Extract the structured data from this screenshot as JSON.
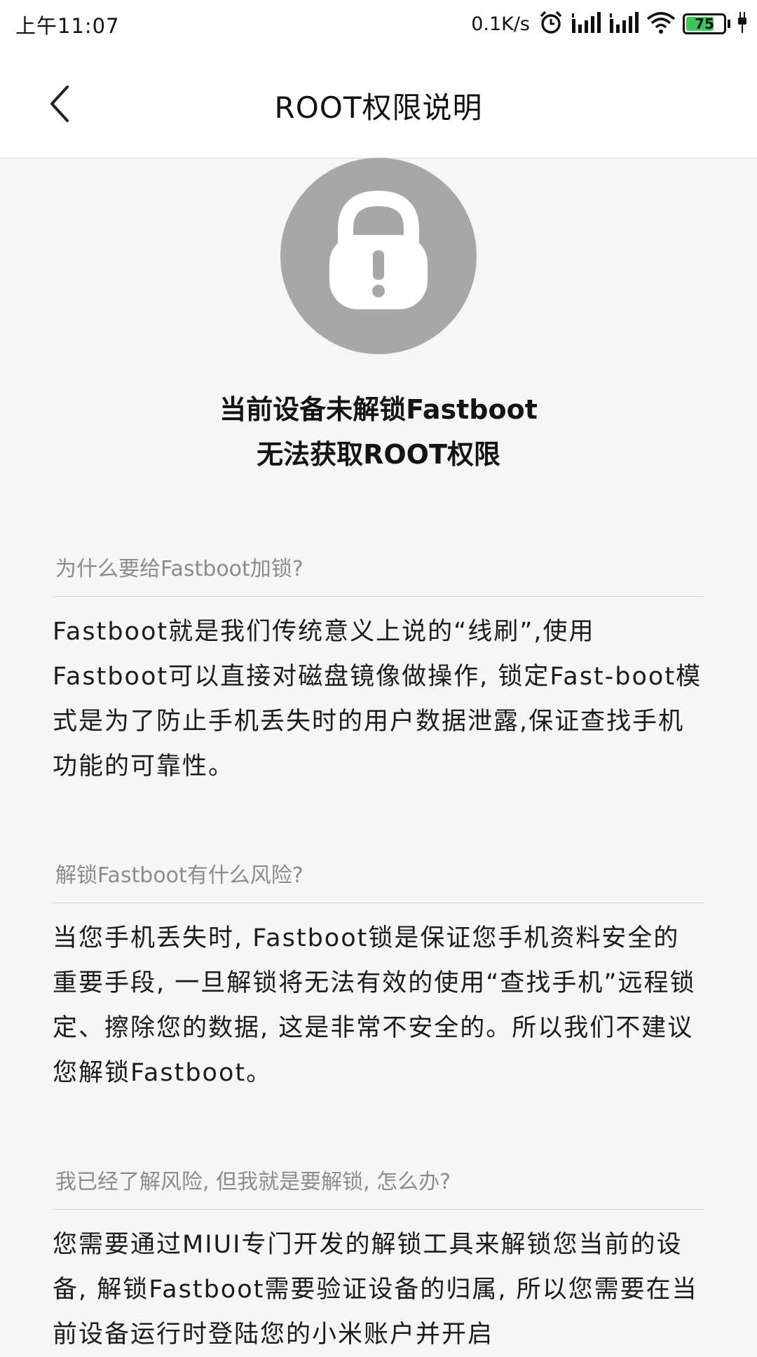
{
  "status_bar": {
    "time": "上午11:07",
    "net_speed": "0.1K/s",
    "battery_level": "75",
    "battery_fraction": 0.75,
    "icons": [
      "alarm-icon",
      "signal-icon",
      "signal-icon",
      "wifi-icon",
      "battery-icon",
      "charging-icon"
    ]
  },
  "header": {
    "title": "ROOT权限说明",
    "back_icon": "chevron-left-icon"
  },
  "hero": {
    "icon": "lock-warning-icon",
    "line1": "当前设备未解锁Fastboot",
    "line2": "无法获取ROOT权限"
  },
  "sections": [
    {
      "question": "为什么要给Fastboot加锁?",
      "body": "Fastboot就是我们传统意义上说的“线刷”,使用Fastboot可以直接对磁盘镜像做操作, 锁定Fast-boot模式是为了防止手机丢失时的用户数据泄露,保证查找手机功能的可靠性。"
    },
    {
      "question": "解锁Fastboot有什么风险?",
      "body": "当您手机丢失时, Fastboot锁是保证您手机资料安全的重要手段, 一旦解锁将无法有效的使用“查找手机”远程锁定、擦除您的数据, 这是非常不安全的。所以我们不建议您解锁Fastboot。"
    },
    {
      "question": "我已经了解风险, 但我就是要解锁, 怎么办?",
      "body": "您需要通过MIUI专门开发的解锁工具来解锁您当前的设备, 解锁Fastboot需要验证设备的归属, 所以您需要在当前设备运行时登陆您的小米账户并开启"
    }
  ],
  "colors": {
    "background": "#f6f6f6",
    "circle": "#a7a7a7",
    "question_text": "#8c8c8c",
    "battery_green": "#3dc65a"
  }
}
